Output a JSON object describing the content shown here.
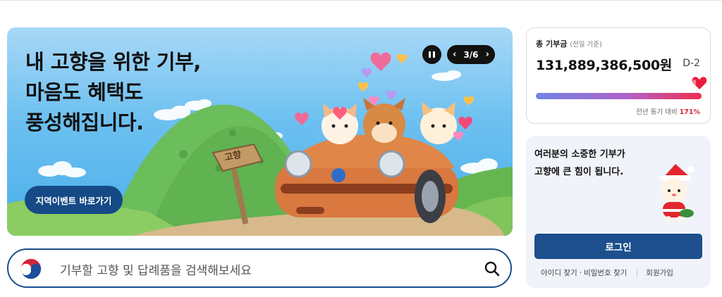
{
  "banner": {
    "headline": [
      "내 고향을 위한 기부,",
      "마음도 혜택도",
      "풍성해집니다."
    ],
    "event_button": "지역이벤트 바로가기",
    "sign_text": "고향",
    "pager": {
      "current": "3",
      "separator": "/",
      "total": "6",
      "text": "3/6"
    },
    "pause_icon": "pause-icon",
    "prev_icon": "chevron-left-icon",
    "next_icon": "chevron-right-icon"
  },
  "search": {
    "placeholder": "기부할 고향 및 답례품을 검색해보세요",
    "logo_icon": "taegeuk-logo-icon",
    "search_icon": "search-icon"
  },
  "donation": {
    "label": "총 기부금",
    "sub_label": "(전일 기준)",
    "amount": "131,889,386,500원",
    "dday": "D-2",
    "compare_label": "전년 동기 대비",
    "compare_value": "171%",
    "progress_percent": 100,
    "colors": {
      "bar_start": "#6f84e6",
      "bar_end": "#ef2d52",
      "compare": "#d8243d"
    }
  },
  "login": {
    "message": [
      "여러분의 소중한 기부가",
      "고향에 큰 힘이 됩니다."
    ],
    "login_button": "로그인",
    "find_id": "아이디 찾기",
    "find_pw": "비밀번호 찾기",
    "dot": "·",
    "signup": "회원가입",
    "colors": {
      "button": "#1c4f8c",
      "card_bg": "#f1f3fa"
    }
  }
}
